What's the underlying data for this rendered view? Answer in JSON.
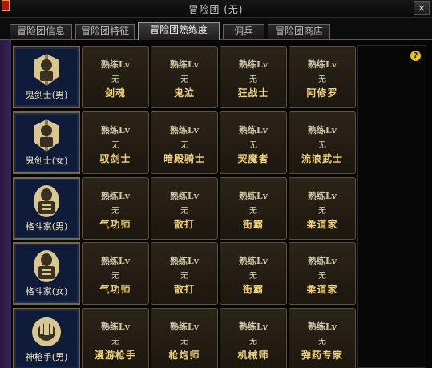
{
  "window": {
    "title": "冒险团 (无)",
    "close_label": "×"
  },
  "tabs": [
    {
      "label": "冒险团信息",
      "active": false
    },
    {
      "label": "冒险团特征",
      "active": false
    },
    {
      "label": "冒险团熟练度",
      "active": true
    },
    {
      "label": "佣兵",
      "active": false
    },
    {
      "label": "冒险团商店",
      "active": false
    }
  ],
  "help_label": "?",
  "colors": {
    "accent_gold": "#f0d27a",
    "card_bg": "#2b2418",
    "char_card_bg": "#0e1c3a",
    "help_badge": "#e8c020"
  },
  "rows": [
    {
      "character": {
        "name": "鬼剑士(男)",
        "icon": "ghost-swordsman-icon"
      },
      "skills": [
        {
          "lv_label": "熟练Lv",
          "lv_value": "无",
          "name": "剑魂"
        },
        {
          "lv_label": "熟练Lv",
          "lv_value": "无",
          "name": "鬼泣"
        },
        {
          "lv_label": "熟练Lv",
          "lv_value": "无",
          "name": "狂战士"
        },
        {
          "lv_label": "熟练Lv",
          "lv_value": "无",
          "name": "阿修罗"
        }
      ]
    },
    {
      "character": {
        "name": "鬼剑士(女)",
        "icon": "ghost-swordsman-icon"
      },
      "skills": [
        {
          "lv_label": "熟练Lv",
          "lv_value": "无",
          "name": "驭剑士"
        },
        {
          "lv_label": "熟练Lv",
          "lv_value": "无",
          "name": "暗殿骑士"
        },
        {
          "lv_label": "熟练Lv",
          "lv_value": "无",
          "name": "契魔者"
        },
        {
          "lv_label": "熟练Lv",
          "lv_value": "无",
          "name": "流浪武士"
        }
      ]
    },
    {
      "character": {
        "name": "格斗家(男)",
        "icon": "fighter-icon"
      },
      "skills": [
        {
          "lv_label": "熟练Lv",
          "lv_value": "无",
          "name": "气功师"
        },
        {
          "lv_label": "熟练Lv",
          "lv_value": "无",
          "name": "散打"
        },
        {
          "lv_label": "熟练Lv",
          "lv_value": "无",
          "name": "街霸"
        },
        {
          "lv_label": "熟练Lv",
          "lv_value": "无",
          "name": "柔道家"
        }
      ]
    },
    {
      "character": {
        "name": "格斗家(女)",
        "icon": "fighter-icon"
      },
      "skills": [
        {
          "lv_label": "熟练Lv",
          "lv_value": "无",
          "name": "气功师"
        },
        {
          "lv_label": "熟练Lv",
          "lv_value": "无",
          "name": "散打"
        },
        {
          "lv_label": "熟练Lv",
          "lv_value": "无",
          "name": "街霸"
        },
        {
          "lv_label": "熟练Lv",
          "lv_value": "无",
          "name": "柔道家"
        }
      ]
    },
    {
      "character": {
        "name": "神枪手(男)",
        "icon": "gunner-icon"
      },
      "skills": [
        {
          "lv_label": "熟练Lv",
          "lv_value": "无",
          "name": "漫游枪手"
        },
        {
          "lv_label": "熟练Lv",
          "lv_value": "无",
          "name": "枪炮师"
        },
        {
          "lv_label": "熟练Lv",
          "lv_value": "无",
          "name": "机械师"
        },
        {
          "lv_label": "熟练Lv",
          "lv_value": "无",
          "name": "弹药专家"
        }
      ]
    }
  ]
}
